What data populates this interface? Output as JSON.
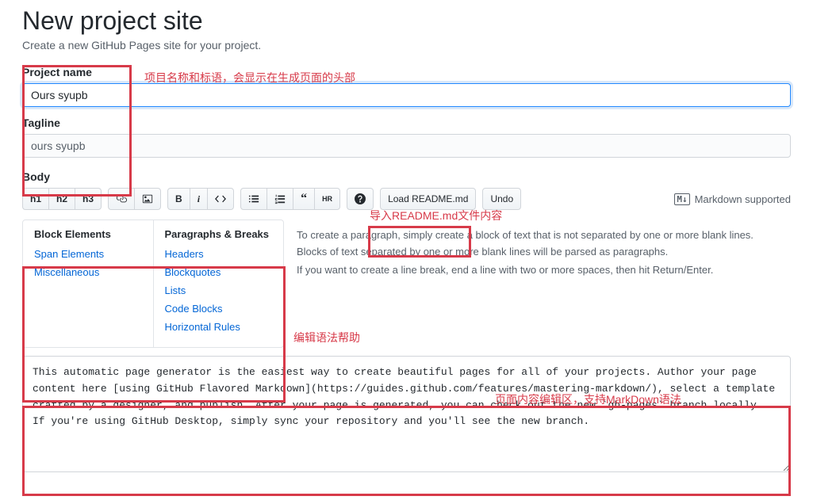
{
  "header": {
    "title": "New project site",
    "subtitle": "Create a new GitHub Pages site for your project."
  },
  "fields": {
    "project_name_label": "Project name",
    "project_name_value": "Ours syupb",
    "tagline_label": "Tagline",
    "tagline_value": "ours syupb",
    "body_label": "Body"
  },
  "toolbar": {
    "h1": "h1",
    "h2": "h2",
    "h3": "h3",
    "load_readme": "Load README.md",
    "undo": "Undo",
    "md_supported": "Markdown supported",
    "md_glyph": "M↓"
  },
  "help": {
    "col1_title": "Block Elements",
    "col1_items": [
      "Span Elements",
      "Miscellaneous"
    ],
    "col2_title": "Paragraphs & Breaks",
    "col2_items": [
      "Headers",
      "Blockquotes",
      "Lists",
      "Code Blocks",
      "Horizontal Rules"
    ],
    "text_p1": "To create a paragraph, simply create a block of text that is not separated by one or more blank lines. Blocks of text separated by one or more blank lines will be parsed as paragraphs.",
    "text_p2": "If you want to create a line break, end a line with two or more spaces, then hit Return/Enter."
  },
  "body_text": "This automatic page generator is the easiest way to create beautiful pages for all of your projects. Author your page content here [using GitHub Flavored Markdown](https://guides.github.com/features/mastering-markdown/), select a template crafted by a designer, and publish. After your page is generated, you can check out the new `gh-pages` branch locally. If you're using GitHub Desktop, simply sync your repository and you'll see the new branch.",
  "annotations": {
    "a1": "项目名称和标语，会显示在生成页面的头部",
    "a2": "导入README.md文件内容",
    "a3": "编辑语法帮助",
    "a4": "页面内容编辑区，支持MarkDown语法"
  }
}
